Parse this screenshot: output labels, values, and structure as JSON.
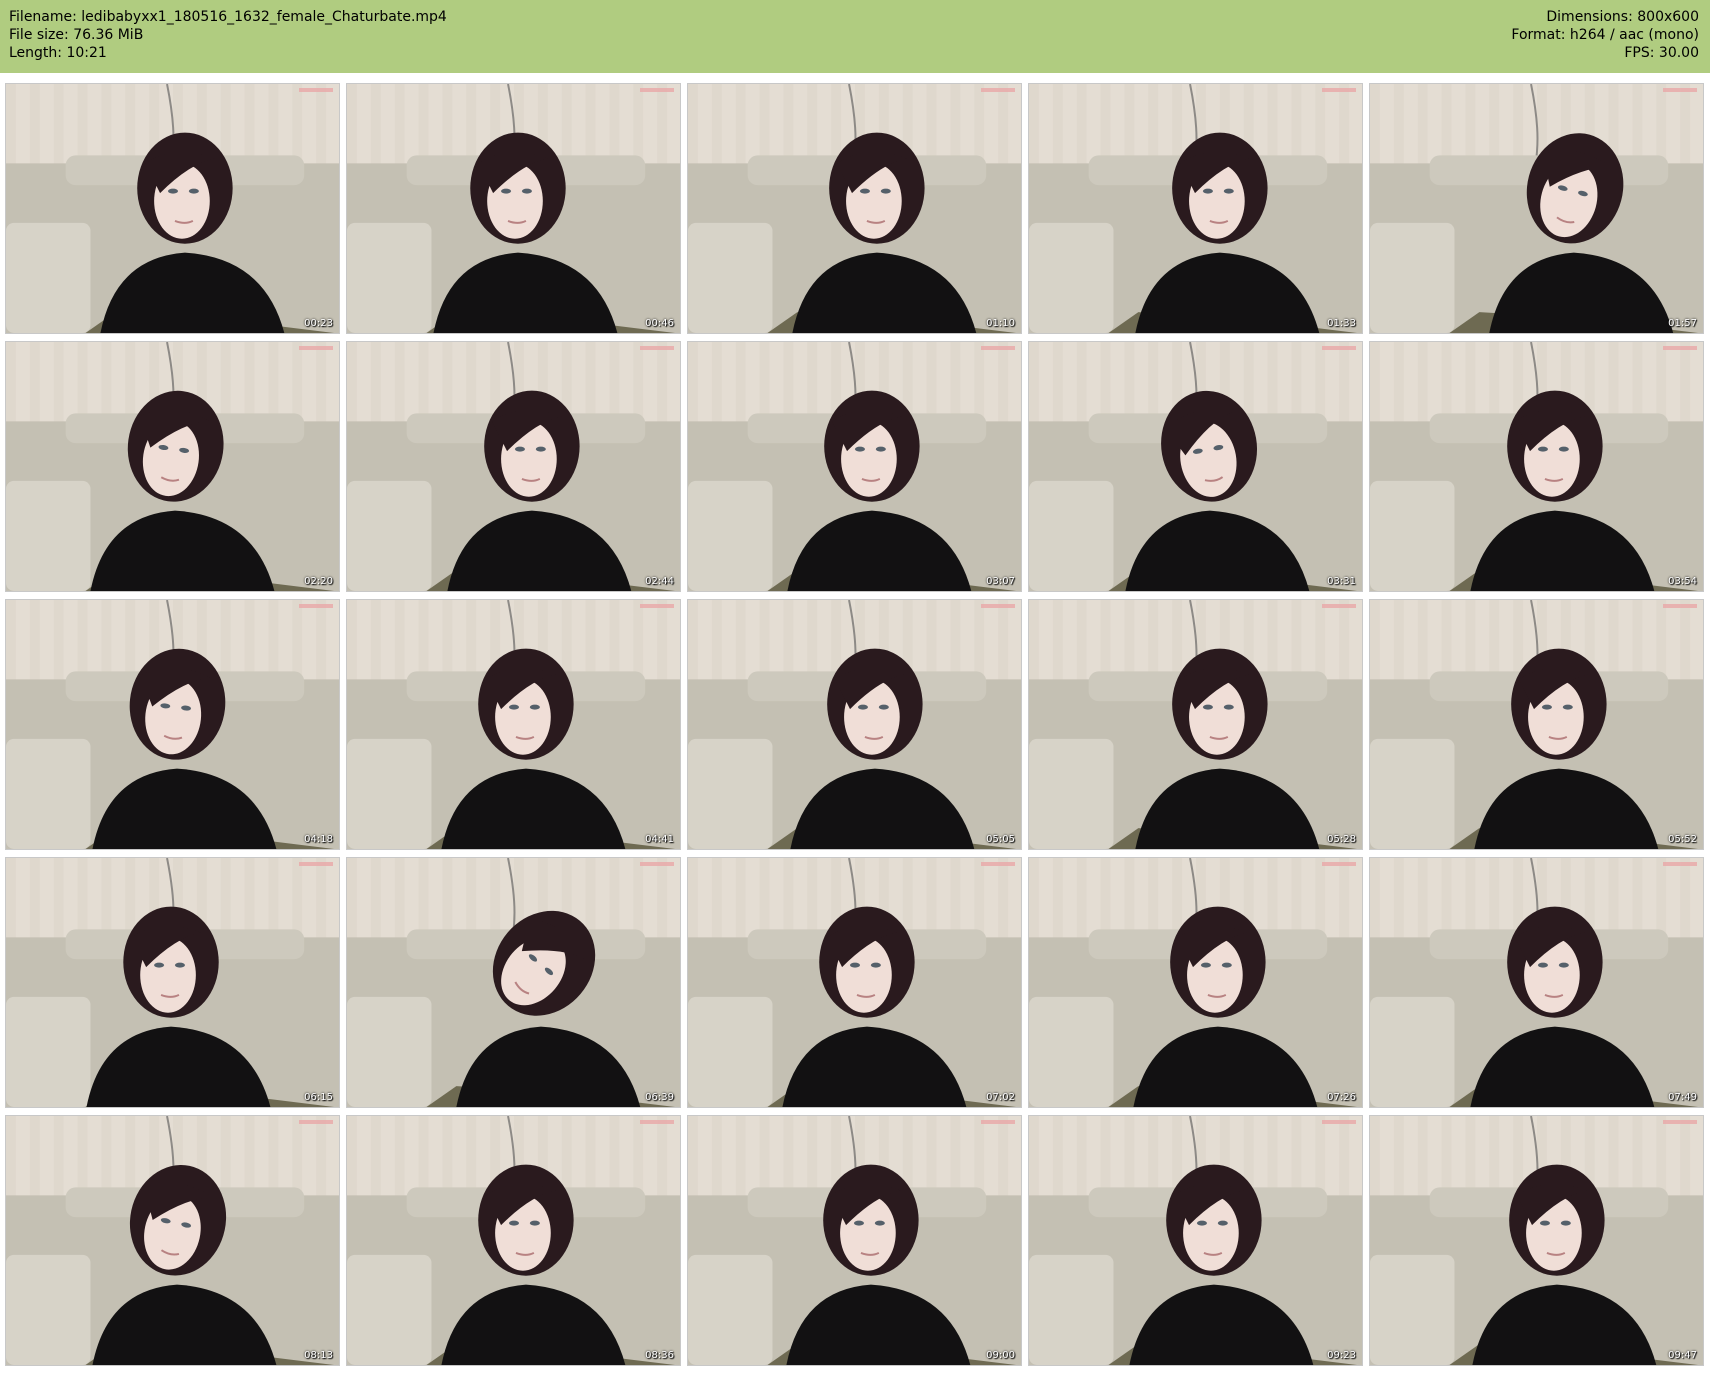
{
  "header": {
    "left": [
      "Filename: ledibabyxx1_180516_1632_female_Chaturbate.mp4",
      "File size: 76.36 MiB",
      "Length: 10:21"
    ],
    "right": [
      "Dimensions: 800x600",
      "Format: h264 / aac (mono)",
      "FPS: 30.00"
    ]
  },
  "thumbnails": [
    {
      "time": "00:23"
    },
    {
      "time": "00:46"
    },
    {
      "time": "01:10"
    },
    {
      "time": "01:33"
    },
    {
      "time": "01:57"
    },
    {
      "time": "02:20"
    },
    {
      "time": "02:44"
    },
    {
      "time": "03:07"
    },
    {
      "time": "03:31"
    },
    {
      "time": "03:54"
    },
    {
      "time": "04:18"
    },
    {
      "time": "04:41"
    },
    {
      "time": "05:05"
    },
    {
      "time": "05:28"
    },
    {
      "time": "05:52"
    },
    {
      "time": "06:15"
    },
    {
      "time": "06:39"
    },
    {
      "time": "07:02"
    },
    {
      "time": "07:26"
    },
    {
      "time": "07:49"
    },
    {
      "time": "08:13"
    },
    {
      "time": "08:36"
    },
    {
      "time": "09:00"
    },
    {
      "time": "09:23"
    },
    {
      "time": "09:47"
    }
  ],
  "colors": {
    "header_bg": "#b0cc80",
    "wall": "#e4ddd3",
    "couch": "#c4c0b3",
    "hair": "#2a1a1e",
    "skin": "#f0ded7",
    "clothing": "#121112"
  }
}
